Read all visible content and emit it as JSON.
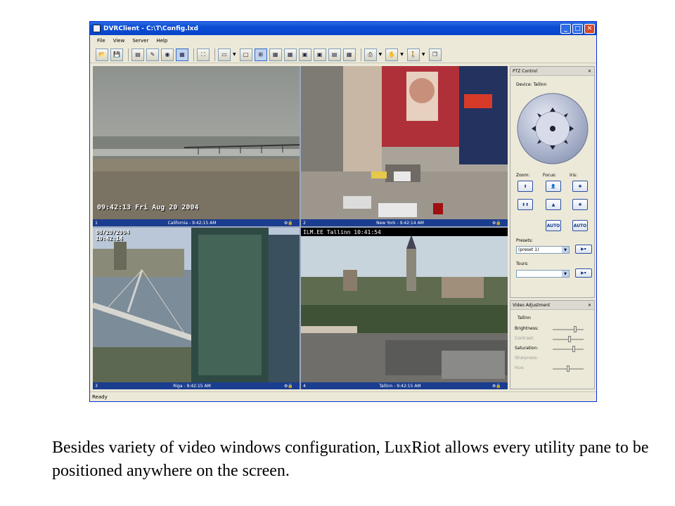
{
  "window": {
    "title": "DVRClient - C:\\T\\Config.lxd",
    "controls": [
      "minimize",
      "maximize",
      "close"
    ]
  },
  "menu": [
    "File",
    "View",
    "Server",
    "Help"
  ],
  "toolbar_icons": [
    "open-icon",
    "save-icon",
    "properties-icon",
    "edit-icon",
    "record-icon",
    "archive-icon",
    "fullscreen-icon",
    "monitor-icon",
    "layout-1x1",
    "layout-2x2",
    "layout-3x3",
    "layout-4x4",
    "layout-1p5",
    "layout-1p7",
    "layout-2p8",
    "layout-4x4b",
    "snapshot-icon",
    "ptz-hand-icon",
    "motion-icon",
    "window-icon"
  ],
  "videos": [
    {
      "num": "1",
      "caption": "California - 9:42:15 AM",
      "osd": "09:42:13 Fri Aug 20 2004"
    },
    {
      "num": "2",
      "caption": "New York - 9:42:14 AM",
      "osd": ""
    },
    {
      "num": "3",
      "caption": "Riga - 9:42:15 AM",
      "osd": "08/20/2004\n10:42:14"
    },
    {
      "num": "4",
      "caption": "Tallinn - 9:42:15 AM",
      "osd": "ILM.EE Tallinn  10:41:54"
    }
  ],
  "ptz": {
    "title": "PTZ Control",
    "device": "Device: Tallinn",
    "zoom": "Zoom:",
    "focus": "Focus:",
    "iris": "Iris:",
    "auto1": "AUTO",
    "auto2": "AUTO",
    "presets_label": "Presets:",
    "preset_value": "(preset 1)",
    "tours_label": "Tours:",
    "tour_value": ""
  },
  "video_adjustment": {
    "title": "Video Adjustment",
    "camera": "Tallinn",
    "brightness": "Brightness:",
    "contrast": "Contrast:",
    "saturation": "Saturation:",
    "sharpness": "Sharpness:",
    "hue": "Hue:",
    "levels": {
      "brightness": 0.75,
      "contrast": 0.55,
      "saturation": 0.7,
      "hue": 0.5
    }
  },
  "status_text": "Ready",
  "caption": "Besides variety of video windows configuration, LuxRiot allows every utility pane to be positioned anywhere on the screen."
}
